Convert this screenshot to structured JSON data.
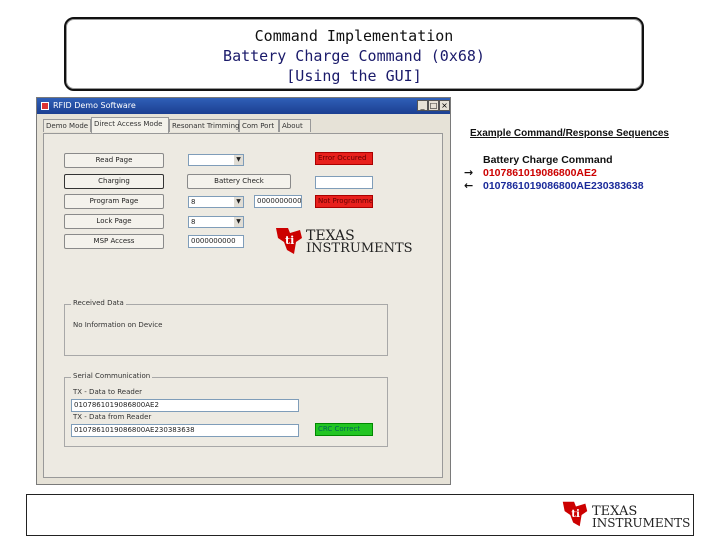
{
  "slide": {
    "title_lines": [
      "Command Implementation",
      "Battery Charge Command (0x68)",
      "[Using the GUI]"
    ]
  },
  "app": {
    "window_title": "RFID Demo Software",
    "window_buttons": [
      "_",
      "□",
      "×"
    ],
    "tabs": [
      "Demo Mode",
      "Direct Access Mode",
      "Resonant Trimming",
      "Com Port",
      "About"
    ],
    "buttons": {
      "read_page": "Read Page",
      "charging": "Charging",
      "program_page": "Program Page",
      "lock_page": "Lock Page",
      "msp_access": "MSP Access",
      "battery_check": "Battery Check"
    },
    "combos": {
      "read_page": "",
      "program_page": "8",
      "lock_page": "8"
    },
    "fields": {
      "program_data": "0000000000",
      "msp_data": "0000000000",
      "status_red1": "Error Occured",
      "status_white": "",
      "status_red2": "Not Programmed"
    },
    "received_group": {
      "label": "Received Data",
      "text": "No Information on Device"
    },
    "serial_group": {
      "label": "Serial Communication",
      "tx_label": "TX - Data to Reader",
      "tx_value": "0107861019086800AE2",
      "rx_label": "TX - Data from Reader",
      "rx_value": "0107861019086800AE230383638",
      "crc_status": "CRC Correct"
    }
  },
  "logo": {
    "line1": "TEXAS",
    "line2": "INSTRUMENTS",
    "color": "#cc0000"
  },
  "example": {
    "heading": "Example Command/Response Sequences",
    "label": "Battery Charge Command",
    "request": "0107861019086800AE2",
    "response": "0107861019086800AE230383638",
    "request_color": "#cc0000",
    "response_color": "#1a2a9a"
  },
  "footer_logo": {
    "line1": "TEXAS",
    "line2": "INSTRUMENTS"
  }
}
